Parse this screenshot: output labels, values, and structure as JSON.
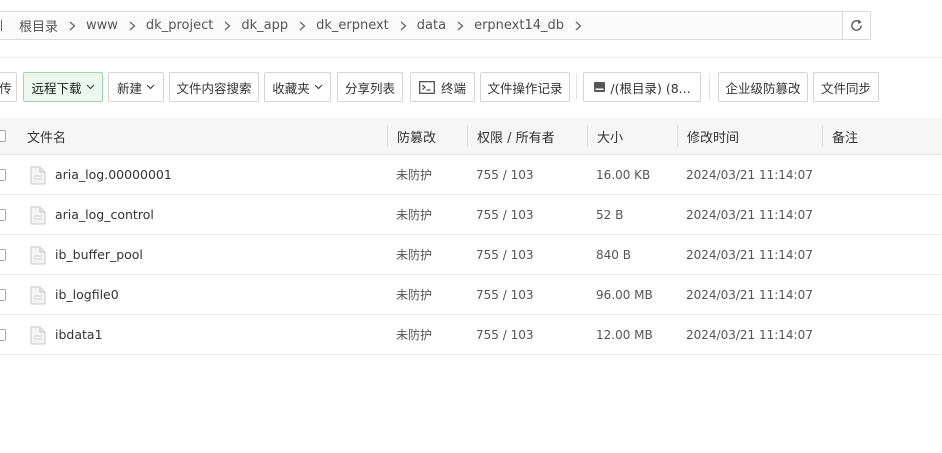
{
  "breadcrumb": {
    "items": [
      "根目录",
      "www",
      "dk_project",
      "dk_app",
      "dk_erpnext",
      "data",
      "erpnext14_db"
    ]
  },
  "toolbar": {
    "upload_partial": "传",
    "remote_download": "远程下载",
    "new": "新建",
    "content_search": "文件内容搜索",
    "favorites": "收藏夹",
    "share_list": "分享列表",
    "terminal": "终端",
    "op_log": "文件操作记录",
    "disk": "/(根目录) (8...",
    "tamper_proof": "企业级防篡改",
    "file_sync": "文件同步"
  },
  "table": {
    "headers": {
      "name": "文件名",
      "protect": "防篡改",
      "perm": "权限 / 所有者",
      "size": "大小",
      "mtime": "修改时间",
      "note": "备注"
    },
    "rows": [
      {
        "name": "aria_log.00000001",
        "protect": "未防护",
        "perm": "755 / 103",
        "size": "16.00 KB",
        "mtime": "2024/03/21 11:14:07"
      },
      {
        "name": "aria_log_control",
        "protect": "未防护",
        "perm": "755 / 103",
        "size": "52 B",
        "mtime": "2024/03/21 11:14:07"
      },
      {
        "name": "ib_buffer_pool",
        "protect": "未防护",
        "perm": "755 / 103",
        "size": "840 B",
        "mtime": "2024/03/21 11:14:07"
      },
      {
        "name": "ib_logfile0",
        "protect": "未防护",
        "perm": "755 / 103",
        "size": "96.00 MB",
        "mtime": "2024/03/21 11:14:07"
      },
      {
        "name": "ibdata1",
        "protect": "未防护",
        "perm": "755 / 103",
        "size": "12.00 MB",
        "mtime": "2024/03/21 11:14:07"
      }
    ]
  },
  "colors": {
    "accent_green_bg": "#ecf8ef",
    "accent_green_border": "#9ed6ab"
  }
}
